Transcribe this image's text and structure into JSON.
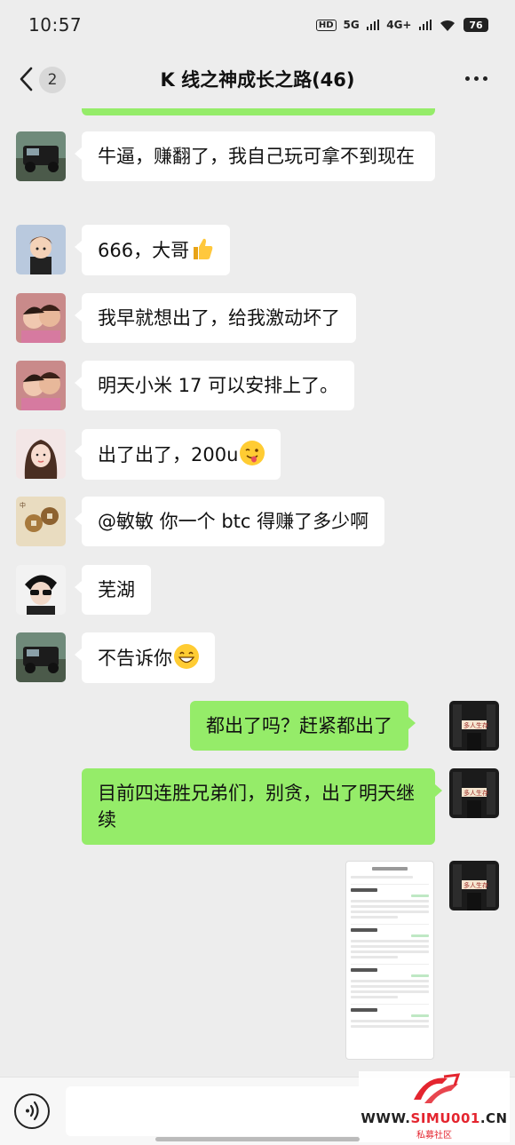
{
  "status_bar": {
    "time": "10:57",
    "hd": "HD",
    "net1": "5G",
    "net2": "4G+",
    "battery": "76"
  },
  "header": {
    "back_count": "2",
    "title": "K 线之神成长之路(46)"
  },
  "messages": [
    {
      "side": "in",
      "avatar": "avatar-jeep",
      "text": "牛逼，赚翻了，我自己玩可拿不到现在"
    },
    {
      "side": "in",
      "avatar": "avatar-cartoon-boy",
      "text": "666，大哥",
      "emoji": "thumbs-up-icon"
    },
    {
      "side": "in",
      "avatar": "avatar-couple",
      "text": "我早就想出了，给我激动坏了"
    },
    {
      "side": "in",
      "avatar": "avatar-couple",
      "text": "明天小米 17 可以安排上了。"
    },
    {
      "side": "in",
      "avatar": "avatar-girl",
      "text": "出了出了，200u",
      "emoji": "wink-tongue-emoji-icon"
    },
    {
      "side": "in",
      "avatar": "avatar-coins",
      "text": "@敏敏 你一个 btc 得赚了多少啊"
    },
    {
      "side": "in",
      "avatar": "avatar-sunglasses",
      "text": "芜湖"
    },
    {
      "side": "in",
      "avatar": "avatar-jeep",
      "text": "不告诉你",
      "emoji": "grin-emoji-icon"
    },
    {
      "side": "out",
      "avatar": "avatar-self",
      "text": "都出了吗？赶紧都出了"
    },
    {
      "side": "out",
      "avatar": "avatar-self",
      "text": "目前四连胜兄弟们，别贪，出了明天继续"
    },
    {
      "side": "out",
      "avatar": "avatar-self",
      "type": "image"
    }
  ],
  "watermark": {
    "site_prefix": "WWW.",
    "site_brand": "SIMU001",
    "site_suffix": ".CN",
    "subtitle": "私募社区"
  },
  "colors": {
    "background": "#ededed",
    "bubble_out": "#95ec69",
    "bubble_in": "#ffffff",
    "brand_red": "#e4252f"
  }
}
